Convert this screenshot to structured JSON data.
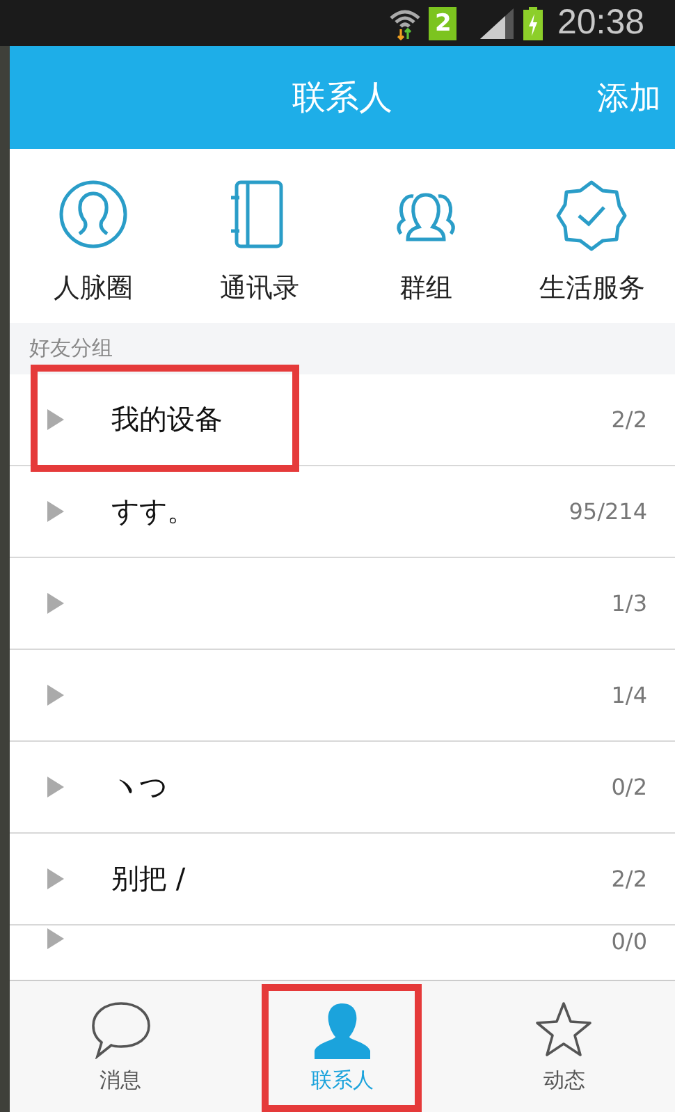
{
  "status_bar": {
    "sim_slot": "2",
    "time": "20:38"
  },
  "header": {
    "title": "联系人",
    "action": "添加"
  },
  "shortcuts": [
    {
      "kind": "circle-person",
      "label": "人脉圈"
    },
    {
      "kind": "book",
      "label": "通讯录"
    },
    {
      "kind": "people",
      "label": "群组"
    },
    {
      "kind": "badge",
      "label": "生活服务"
    }
  ],
  "groups": {
    "title": "好友分组",
    "items": [
      {
        "name": "我的设备",
        "count": "2/2",
        "highlighted": true
      },
      {
        "name": "すす。",
        "count": "95/214",
        "highlighted": false
      },
      {
        "count": "1/3",
        "highlighted": false
      },
      {
        "count": "1/4",
        "highlighted": false
      },
      {
        "name": "ヽつ",
        "count": "0/2",
        "highlighted": false
      },
      {
        "name": "别把 /",
        "count": "2/2",
        "highlighted": false
      },
      {
        "count": "0/0",
        "highlighted": false
      }
    ]
  },
  "tabs": [
    {
      "kind": "chat",
      "label": "消息",
      "selected": false,
      "highlighted": false
    },
    {
      "kind": "person",
      "label": "联系人",
      "selected": true,
      "highlighted": true
    },
    {
      "kind": "star",
      "label": "动态",
      "selected": false,
      "highlighted": false
    }
  ]
}
